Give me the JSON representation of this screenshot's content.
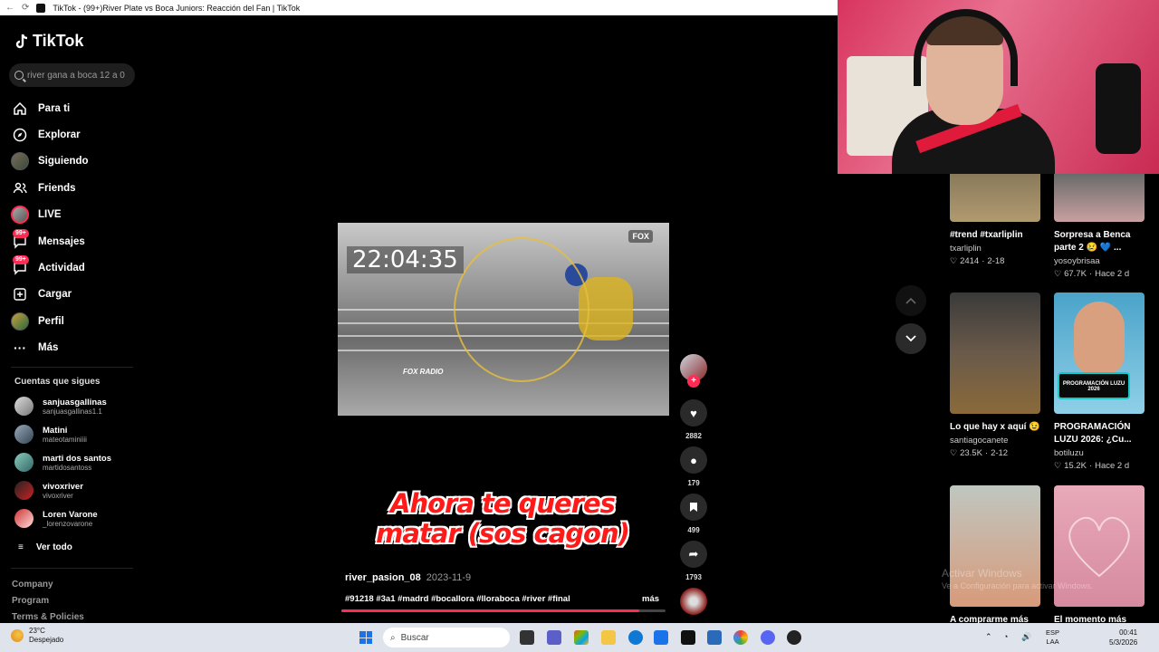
{
  "browser": {
    "tab_title": "TikTok - (99+)River Plate vs Boca Juniors: Reacción del Fan | TikTok"
  },
  "sidebar": {
    "logo": "TikTok",
    "search_value": "river gana a boca 12 a 0",
    "nav": [
      {
        "label": "Para ti",
        "icon": "home-icon"
      },
      {
        "label": "Explorar",
        "icon": "compass-icon"
      },
      {
        "label": "Siguiendo",
        "icon": "avatar"
      },
      {
        "label": "Friends",
        "icon": "people-icon"
      },
      {
        "label": "LIVE",
        "icon": "avatar"
      },
      {
        "label": "Mensajes",
        "icon": "message-icon",
        "badge": "99+"
      },
      {
        "label": "Actividad",
        "icon": "activity-icon",
        "badge": "99+"
      },
      {
        "label": "Cargar",
        "icon": "upload-icon"
      },
      {
        "label": "Perfil",
        "icon": "avatar"
      },
      {
        "label": "Más",
        "icon": "more-icon"
      }
    ],
    "following_title": "Cuentas que sigues",
    "accounts": [
      {
        "name": "sanjuasgallinas",
        "handle": "sanjuasgallinas1.1"
      },
      {
        "name": "Matini",
        "handle": "mateotaminiiii"
      },
      {
        "name": "marti dos santos",
        "handle": "martidosantoss"
      },
      {
        "name": "vivoxriver",
        "handle": "vivoxriver"
      },
      {
        "name": "Loren Varone",
        "handle": "_lorenzovarone"
      }
    ],
    "see_all": "Ver todo",
    "footer": [
      "Company",
      "Program",
      "Terms & Policies"
    ]
  },
  "video": {
    "timestamp_overlay": "22:04:35",
    "channel_logo": "FOX",
    "radio_logo": "FOX RADIO",
    "caption_line1": "Ahora te queres",
    "caption_line2": "matar (sos cagon)",
    "author": "river_pasion_08",
    "date": "2023-11-9",
    "hashtags": "#91218 #3a1 #madrd #bocallora #lloraboca #river #final",
    "more_label": "más",
    "progress": 0.92
  },
  "actions": {
    "likes": "2882",
    "comments": "179",
    "saves": "499",
    "shares": "1793"
  },
  "suggested": [
    {
      "title": "#trend #txarliplin",
      "author": "txarliplin",
      "likes": "2414",
      "date": "2-18"
    },
    {
      "title": "Sorpresa a Benca parte 2 😢 💙 ...",
      "author": "yosoybrisaa",
      "likes": "67.7K",
      "date": "Hace 2 d"
    },
    {
      "title": "Lo que hay x aquí 😉",
      "author": "santiagocanete",
      "likes": "23.5K",
      "date": "2-12"
    },
    {
      "title": "PROGRAMACIÓN LUZU 2026: ¿Cu...",
      "author": "botiluzu",
      "likes": "15.2K",
      "date": "Hace 2 d",
      "thumb_text": "PROGRAMACIÓN LUZU 2026"
    },
    {
      "title": "A comprarme más",
      "author": "",
      "likes": "",
      "date": ""
    },
    {
      "title": "El momento más",
      "author": "",
      "likes": "",
      "date": ""
    }
  ],
  "watermark": {
    "line1": "Activar Windows",
    "line2": "Ve a Configuración para activar Windows."
  },
  "taskbar": {
    "temp": "23°C",
    "weather": "Despejado",
    "search_placeholder": "Buscar",
    "lang1": "ESP",
    "lang2": "LAA",
    "time": "00:41",
    "date": "5/3/2026"
  }
}
